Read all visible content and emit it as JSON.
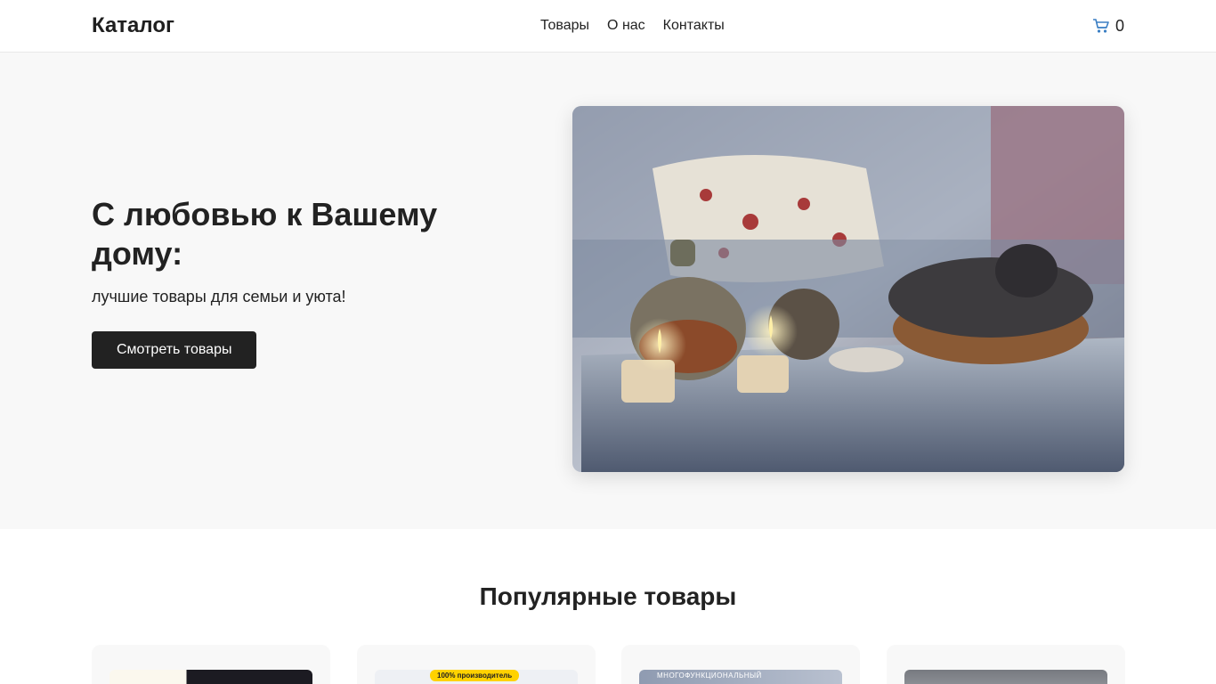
{
  "header": {
    "logo": "Каталог",
    "nav": [
      "Товары",
      "О нас",
      "Контакты"
    ],
    "cart_icon": "shopping-cart-icon",
    "cart_count": "0"
  },
  "hero": {
    "title": "С любовью к Вашему дому:",
    "subtitle": "лучшие товары для семьи и уюта!",
    "button": "Смотреть товары"
  },
  "popular": {
    "title": "Популярные товары",
    "cards": [
      {
        "badge": ""
      },
      {
        "badge": "100% производитель"
      },
      {
        "badge": "МНОГОФУНКЦИОНАЛЬНЫЙ"
      },
      {
        "badge": ""
      }
    ]
  },
  "colors": {
    "accent": "#222222",
    "hero_bg": "#f8f8f8",
    "badge": "#ffd200"
  }
}
